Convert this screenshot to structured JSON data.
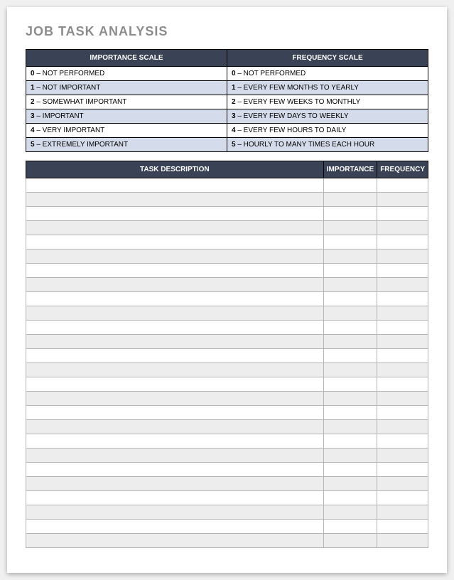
{
  "title": "JOB TASK ANALYSIS",
  "scales": {
    "importance_header": "IMPORTANCE SCALE",
    "frequency_header": "FREQUENCY SCALE",
    "rows": [
      {
        "imp_num": "0",
        "imp_text": " – NOT PERFORMED",
        "freq_num": "0",
        "freq_text": " – NOT PERFORMED",
        "shaded": false
      },
      {
        "imp_num": "1",
        "imp_text": " – NOT IMPORTANT",
        "freq_num": "1",
        "freq_text": " – EVERY FEW MONTHS TO YEARLY",
        "shaded": true
      },
      {
        "imp_num": "2",
        "imp_text": " – SOMEWHAT IMPORTANT",
        "freq_num": "2",
        "freq_text": " – EVERY FEW WEEKS TO MONTHLY",
        "shaded": false
      },
      {
        "imp_num": "3",
        "imp_text": " – IMPORTANT",
        "freq_num": "3",
        "freq_text": " – EVERY FEW DAYS TO WEEKLY",
        "shaded": true
      },
      {
        "imp_num": "4",
        "imp_text": " – VERY IMPORTANT",
        "freq_num": "4",
        "freq_text": " – EVERY FEW HOURS TO DAILY",
        "shaded": false
      },
      {
        "imp_num": "5",
        "imp_text": " – EXTREMELY IMPORTANT",
        "freq_num": "5",
        "freq_text": " – HOURLY TO MANY TIMES EACH HOUR",
        "shaded": true
      }
    ]
  },
  "tasks": {
    "desc_header": "TASK DESCRIPTION",
    "importance_header": "IMPORTANCE",
    "frequency_header": "FREQUENCY",
    "rows": [
      {
        "desc": "",
        "importance": "",
        "frequency": ""
      },
      {
        "desc": "",
        "importance": "",
        "frequency": ""
      },
      {
        "desc": "",
        "importance": "",
        "frequency": ""
      },
      {
        "desc": "",
        "importance": "",
        "frequency": ""
      },
      {
        "desc": "",
        "importance": "",
        "frequency": ""
      },
      {
        "desc": "",
        "importance": "",
        "frequency": ""
      },
      {
        "desc": "",
        "importance": "",
        "frequency": ""
      },
      {
        "desc": "",
        "importance": "",
        "frequency": ""
      },
      {
        "desc": "",
        "importance": "",
        "frequency": ""
      },
      {
        "desc": "",
        "importance": "",
        "frequency": ""
      },
      {
        "desc": "",
        "importance": "",
        "frequency": ""
      },
      {
        "desc": "",
        "importance": "",
        "frequency": ""
      },
      {
        "desc": "",
        "importance": "",
        "frequency": ""
      },
      {
        "desc": "",
        "importance": "",
        "frequency": ""
      },
      {
        "desc": "",
        "importance": "",
        "frequency": ""
      },
      {
        "desc": "",
        "importance": "",
        "frequency": ""
      },
      {
        "desc": "",
        "importance": "",
        "frequency": ""
      },
      {
        "desc": "",
        "importance": "",
        "frequency": ""
      },
      {
        "desc": "",
        "importance": "",
        "frequency": ""
      },
      {
        "desc": "",
        "importance": "",
        "frequency": ""
      },
      {
        "desc": "",
        "importance": "",
        "frequency": ""
      },
      {
        "desc": "",
        "importance": "",
        "frequency": ""
      },
      {
        "desc": "",
        "importance": "",
        "frequency": ""
      },
      {
        "desc": "",
        "importance": "",
        "frequency": ""
      },
      {
        "desc": "",
        "importance": "",
        "frequency": ""
      },
      {
        "desc": "",
        "importance": "",
        "frequency": ""
      }
    ]
  }
}
